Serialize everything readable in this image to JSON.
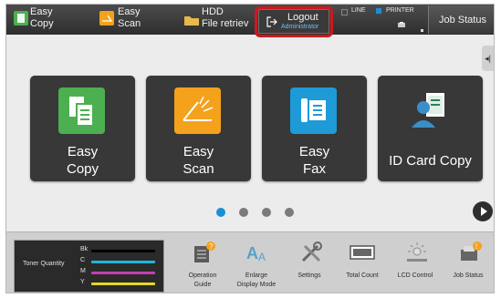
{
  "topbar": {
    "easy_copy": "Easy\nCopy",
    "easy_copy_1": "Easy",
    "easy_copy_2": "Copy",
    "easy_scan_1": "Easy",
    "easy_scan_2": "Scan",
    "hdd_1": "HDD",
    "hdd_2": "File retriev",
    "logout": "Logout",
    "logout_user": "Administrator",
    "line_status": "LINE",
    "printer_status": "PRINTER",
    "job_status": "Job Status",
    "icons": [
      "easy-copy-icon",
      "easy-scan-icon",
      "hdd-folder-icon",
      "logout-icon"
    ]
  },
  "tiles": [
    {
      "label_1": "Easy",
      "label_2": "Copy",
      "icon": "copy-icon",
      "color": "#4caf50"
    },
    {
      "label_1": "Easy",
      "label_2": "Scan",
      "icon": "scan-icon",
      "color": "#f4a21c"
    },
    {
      "label_1": "Easy",
      "label_2": "Fax",
      "icon": "fax-icon",
      "color": "#1e9ad6"
    },
    {
      "label_1": "ID Card Copy",
      "label_2": "",
      "icon": "id-card-copy-icon",
      "color": "#2e7d5e"
    }
  ],
  "pagination": {
    "pages": 4,
    "current": 1
  },
  "toner": {
    "title": "Toner Quantity",
    "rows": [
      {
        "label": "Bk",
        "color": "#000000"
      },
      {
        "label": "C",
        "color": "#1fb6d8"
      },
      {
        "label": "M",
        "color": "#c43fb0"
      },
      {
        "label": "Y",
        "color": "#e6d820"
      }
    ]
  },
  "shortcuts": [
    {
      "label_1": "Operation",
      "label_2": "Guide",
      "icon": "operation-guide-icon"
    },
    {
      "label_1": "Enlarge",
      "label_2": "Display Mode",
      "icon": "enlarge-display-icon"
    },
    {
      "label_1": "Settings",
      "label_2": "",
      "icon": "settings-icon"
    },
    {
      "label_1": "Total Count",
      "label_2": "",
      "icon": "total-count-icon"
    },
    {
      "label_1": "LCD Control",
      "label_2": "",
      "icon": "lcd-control-icon"
    },
    {
      "label_1": "Job Status",
      "label_2": "",
      "icon": "job-status-icon"
    }
  ],
  "colors": {
    "highlight": "#d0171d",
    "accent_blue": "#1a8fd8"
  }
}
